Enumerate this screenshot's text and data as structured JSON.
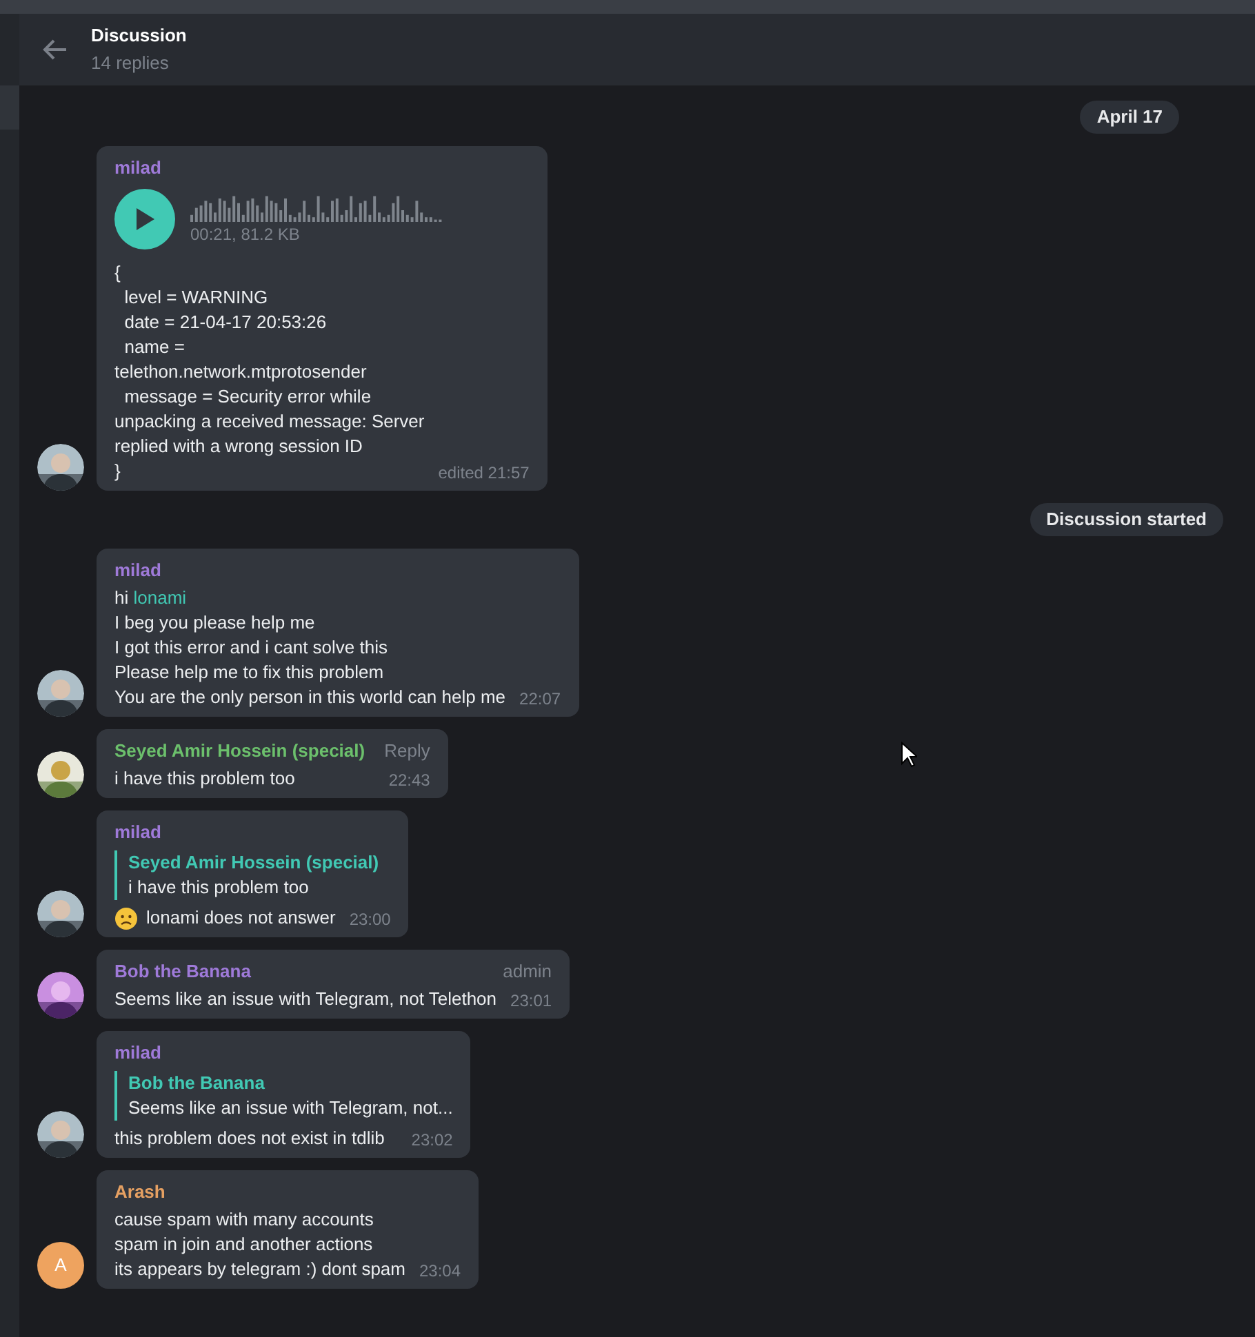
{
  "header": {
    "title": "Discussion",
    "subtitle": "14 replies"
  },
  "feed": [
    {
      "kind": "service",
      "text": "April 17"
    },
    {
      "kind": "message",
      "author": "milad",
      "color": "#9f7ad9",
      "avatar": {
        "kind": "picture"
      },
      "voice": {
        "meta": "00:21, 81.2 KB"
      },
      "segments": [
        {
          "text": "{\n  level = WARNING\n  date = 21-04-17 20:53:26\n  name =\ntelethon.network.mtprotosender\n  message = Security error while\nunpacking a received message: Server\nreplied with a wrong session ID\n}"
        }
      ],
      "time": "edited 21:57"
    },
    {
      "kind": "service",
      "text": "Discussion started"
    },
    {
      "kind": "message",
      "author": "milad",
      "color": "#9f7ad9",
      "avatar": {
        "kind": "picture"
      },
      "segments": [
        {
          "text": "hi "
        },
        {
          "text": "lonami",
          "kind": "mention"
        },
        {
          "text": "\nI beg you please help me\nI got this error and i cant solve this\nPlease help me to fix this problem\nYou are the only person in this world can help me"
        }
      ],
      "time": "22:07"
    },
    {
      "kind": "message",
      "author": "Seyed Amir Hossein (special)",
      "color": "#6cc06c",
      "avatar": {
        "kind": "picture"
      },
      "action": "Reply",
      "segments": [
        {
          "text": "i have this problem too"
        }
      ],
      "time": "22:43"
    },
    {
      "kind": "message",
      "author": "milad",
      "color": "#9f7ad9",
      "avatar": {
        "kind": "picture"
      },
      "quote": {
        "author": "Seyed Amir Hossein (special)",
        "text": "i have this problem too"
      },
      "segments": [
        {
          "kind": "emoji"
        },
        {
          "text": "lonami does not answer"
        }
      ],
      "time": "23:00"
    },
    {
      "kind": "message",
      "author": "Bob the Banana",
      "color": "#9f7ad9",
      "avatar": {
        "kind": "picture"
      },
      "badge": "admin",
      "segments": [
        {
          "text": "Seems like an issue with Telegram, not Telethon"
        }
      ],
      "time": "23:01"
    },
    {
      "kind": "message",
      "author": "milad",
      "color": "#9f7ad9",
      "avatar": {
        "kind": "picture"
      },
      "quote": {
        "author": "Bob the Banana",
        "text": "Seems like an issue with Telegram, not..."
      },
      "segments": [
        {
          "text": "this problem does not exist in tdlib"
        }
      ],
      "time": "23:02"
    },
    {
      "kind": "message",
      "author": "Arash",
      "color": "#e5a062",
      "avatar": {
        "kind": "letter",
        "letter": "A",
        "color": "#eea35f"
      },
      "segments": [
        {
          "text": "cause spam with many accounts\nspam in join and another actions\nits appears by telegram :) dont spam"
        }
      ],
      "time": "23:04"
    }
  ]
}
